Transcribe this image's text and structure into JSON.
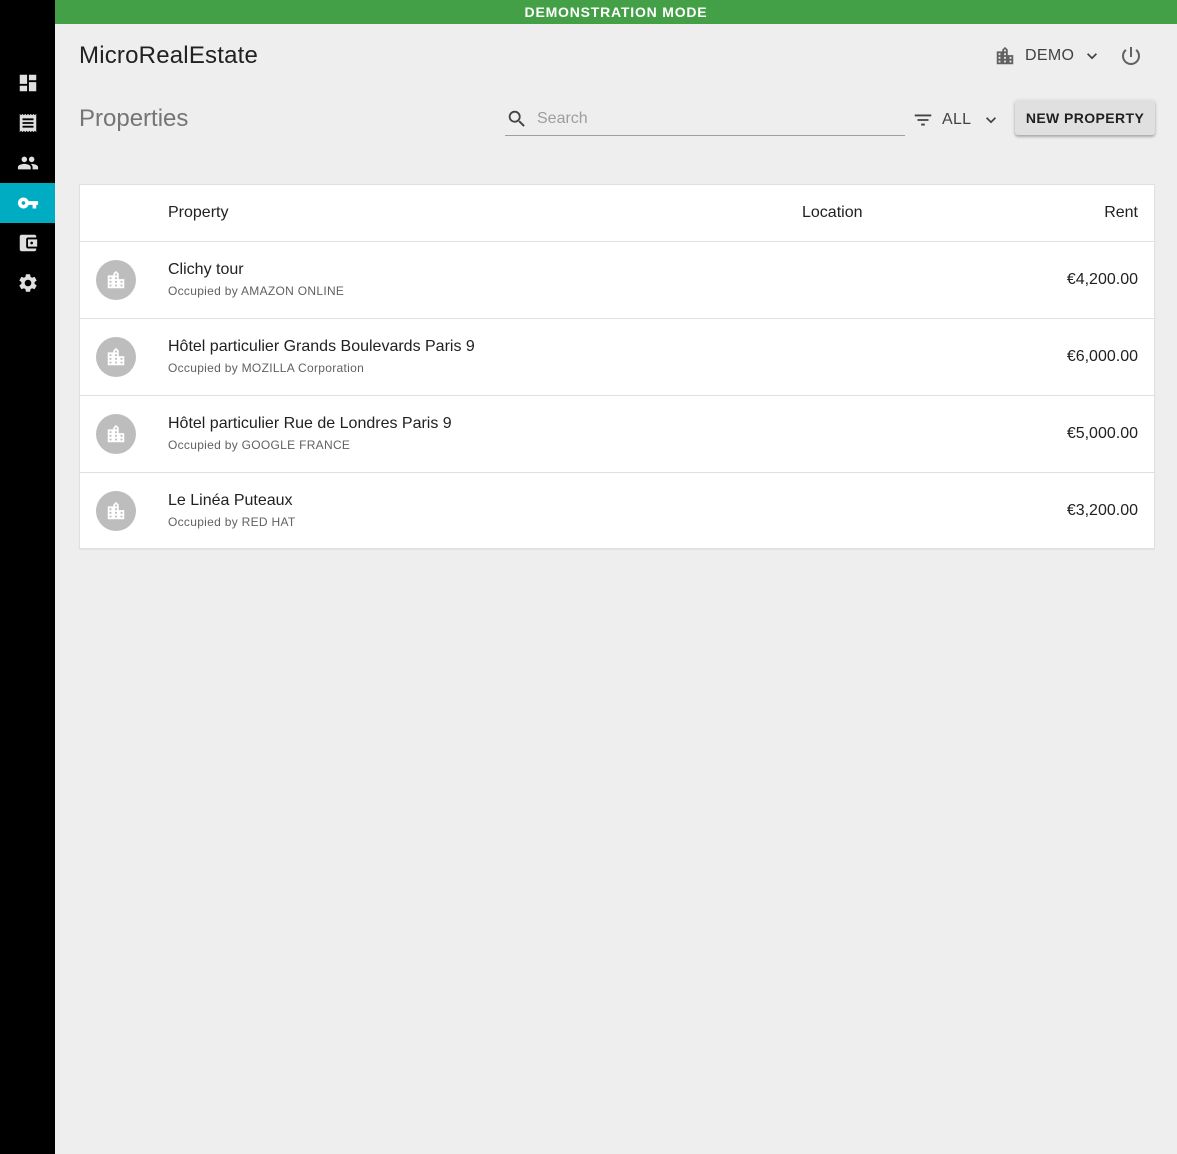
{
  "banner": "DEMONSTRATION MODE",
  "app_title": "MicroRealEstate",
  "sidebar": {
    "items": [
      {
        "icon": "dashboard-icon"
      },
      {
        "icon": "receipt-icon"
      },
      {
        "icon": "people-icon"
      },
      {
        "icon": "key-icon",
        "active": true
      },
      {
        "icon": "wallet-icon"
      },
      {
        "icon": "settings-icon"
      }
    ]
  },
  "header": {
    "organization": "DEMO",
    "org_icon": "building-icon",
    "logout_icon": "power-icon"
  },
  "page": {
    "title": "Properties",
    "search_placeholder": "Search",
    "search_value": "",
    "filter_label": "ALL",
    "new_button": "NEW PROPERTY"
  },
  "table": {
    "columns": [
      "Property",
      "Location",
      "Rent"
    ],
    "rows": [
      {
        "name": "Clichy tour",
        "occupant": "Occupied by AMAZON ONLINE",
        "location": "",
        "rent": "€4,200.00"
      },
      {
        "name": "Hôtel particulier Grands Boulevards Paris 9",
        "occupant": "Occupied by MOZILLA Corporation",
        "location": "",
        "rent": "€6,000.00"
      },
      {
        "name": "Hôtel particulier Rue de Londres Paris 9",
        "occupant": "Occupied by GOOGLE FRANCE",
        "location": "",
        "rent": "€5,000.00"
      },
      {
        "name": "Le Linéa Puteaux",
        "occupant": "Occupied by RED HAT",
        "location": "",
        "rent": "€3,200.00"
      }
    ]
  },
  "colors": {
    "banner": "#43a047",
    "sidebar": "#000000",
    "active_nav": "#00acc1",
    "background": "#eeeeee"
  }
}
